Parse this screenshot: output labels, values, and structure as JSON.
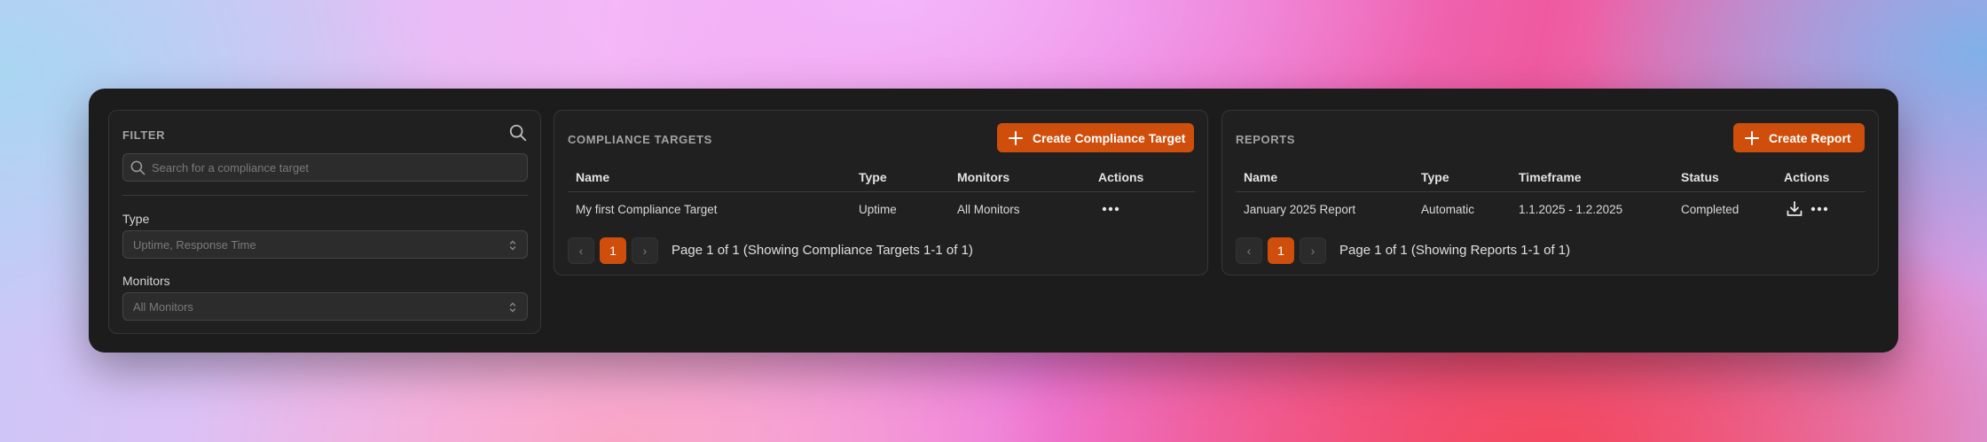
{
  "filter": {
    "title": "FILTER",
    "search_placeholder": "Search for a compliance target",
    "type_label": "Type",
    "type_value": "Uptime, Response Time",
    "monitors_label": "Monitors",
    "monitors_value": "All Monitors"
  },
  "compliance_targets": {
    "title": "COMPLIANCE TARGETS",
    "create_label": "Create Compliance Target",
    "columns": [
      "Name",
      "Type",
      "Monitors",
      "Actions"
    ],
    "rows": [
      {
        "name": "My first Compliance Target",
        "type": "Uptime",
        "monitors": "All Monitors"
      }
    ],
    "pagination": {
      "current": "1",
      "prev": "‹",
      "next": "›",
      "text": "Page 1 of 1 (Showing Compliance Targets 1-1 of 1)"
    }
  },
  "reports": {
    "title": "REPORTS",
    "create_label": "Create Report",
    "columns": [
      "Name",
      "Type",
      "Timeframe",
      "Status",
      "Actions"
    ],
    "rows": [
      {
        "name": "January 2025 Report",
        "type": "Automatic",
        "timeframe": "1.1.2025 - 1.2.2025",
        "status": "Completed"
      }
    ],
    "pagination": {
      "current": "1",
      "prev": "‹",
      "next": "›",
      "text": "Page 1 of 1 (Showing Reports 1-1 of 1)"
    }
  },
  "colors": {
    "accent": "#cf4e0c",
    "panel": "#1c1c1c",
    "card": "#202020"
  },
  "icons": [
    "search-icon",
    "magnifier-icon",
    "chevron-updown-icon",
    "plus-icon",
    "more-dots-icon",
    "download-icon"
  ]
}
